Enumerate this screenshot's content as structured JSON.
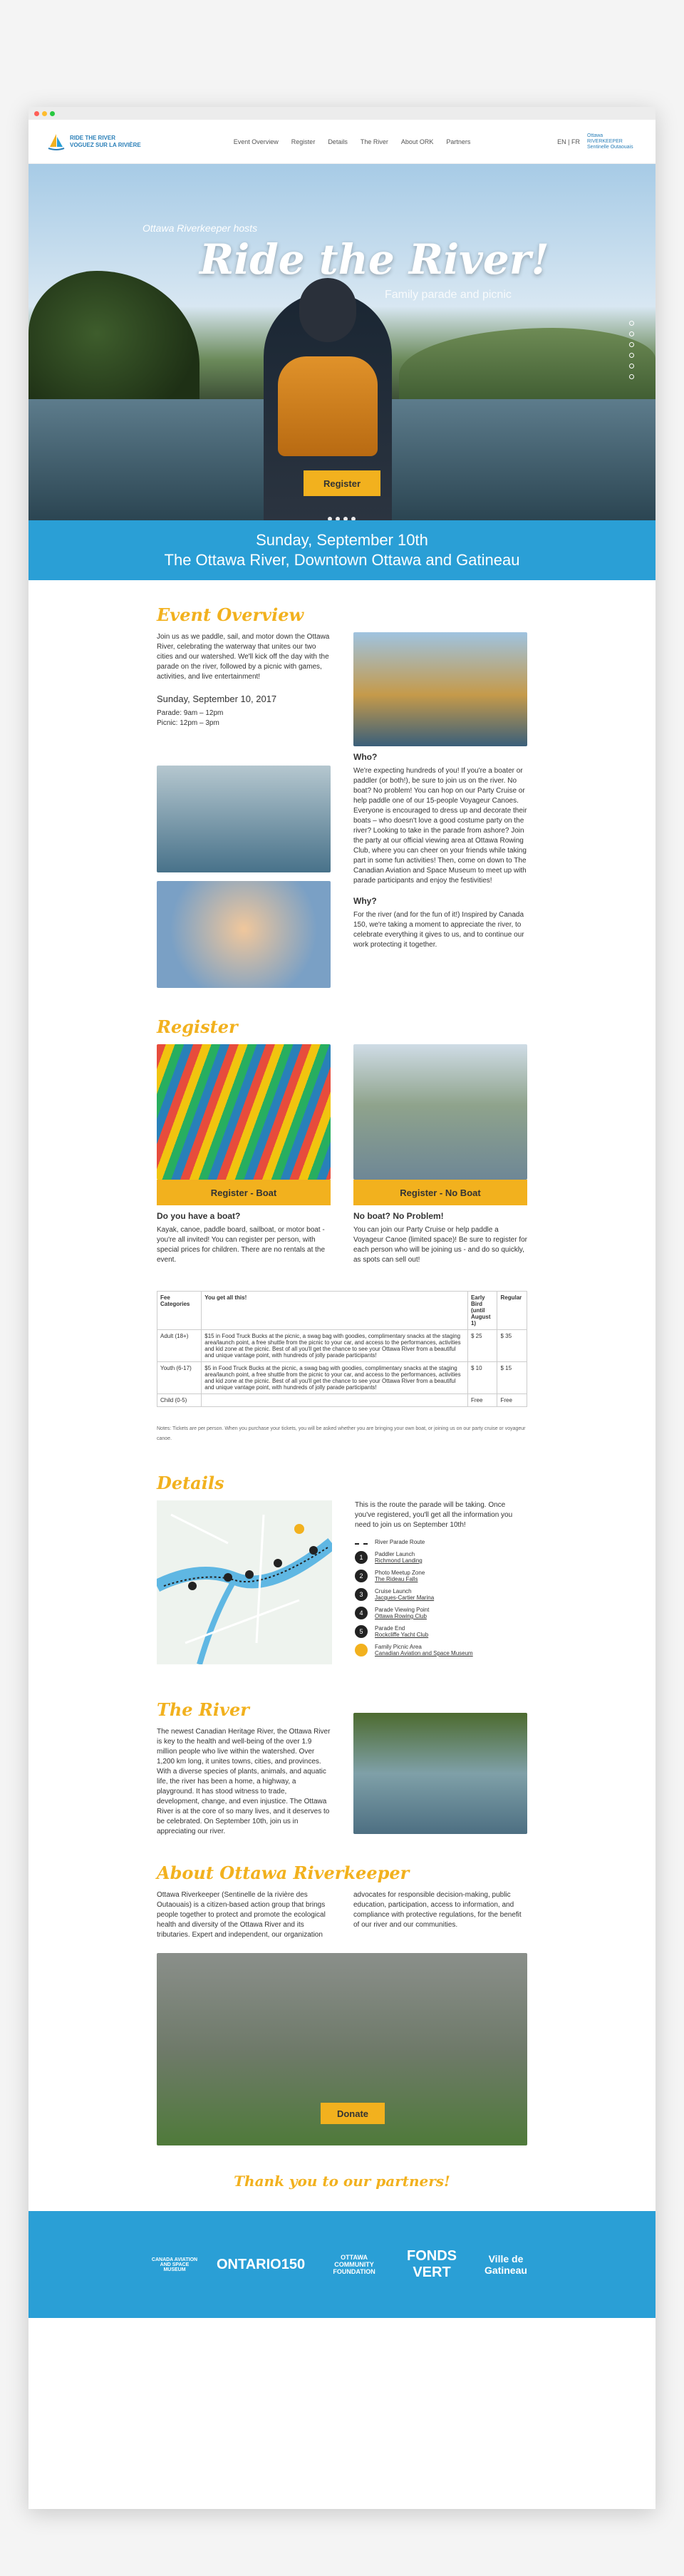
{
  "nav": {
    "logo_line1": "RIDE THE RIVER",
    "logo_line2": "VOGUEZ SUR LA RIVIÈRE",
    "items": [
      "Event Overview",
      "Register",
      "Details",
      "The River",
      "About ORK",
      "Partners"
    ],
    "lang": "EN | FR",
    "partner_logo": "Ottawa RIVERKEEPER Sentinelle Outaouais"
  },
  "hero": {
    "kicker": "Ottawa Riverkeeper hosts",
    "title": "Ride the River!",
    "subtitle": "Family parade and picnic",
    "register_button": "Register"
  },
  "date_band": {
    "line1": "Sunday, September 10th",
    "line2": "The Ottawa River, Downtown Ottawa and Gatineau"
  },
  "overview": {
    "title": "Event Overview",
    "intro": "Join us as we paddle, sail, and motor down the Ottawa River, celebrating the waterway that unites our two cities and our watershed. We'll kick off the day with the parade on the river, followed by a picnic with games, activities, and live entertainment!",
    "date": "Sunday, September 10, 2017",
    "parade": "Parade: 9am – 12pm",
    "picnic": "Picnic: 12pm – 3pm",
    "who_title": "Who?",
    "who_text": "We're expecting hundreds of you! If you're a boater or paddler (or both!), be sure to join us on the river. No boat? No problem! You can hop on our Party Cruise or help paddle one of our 15-people Voyageur Canoes. Everyone is encouraged to dress up and decorate their boats – who doesn't love a good costume party on the river? Looking to take in the parade from ashore? Join the party at our official viewing area at Ottawa Rowing Club, where you can cheer on your friends while taking part in some fun activities! Then, come on down to The Canadian Aviation and Space Museum to meet up with parade participants and enjoy the festivities!",
    "why_title": "Why?",
    "why_text": "For the river (and for the fun of it!) Inspired by Canada 150, we're taking a moment to appreciate the river, to celebrate everything it gives to us, and to continue our work protecting it together."
  },
  "register": {
    "title": "Register",
    "boat_button": "Register - Boat",
    "noboat_button": "Register - No Boat",
    "boat_heading": "Do you have a boat?",
    "boat_text": "Kayak, canoe, paddle board, sailboat, or motor boat - you're all invited! You can register per person, with special prices for children. There are no rentals at the event.",
    "noboat_heading": "No boat? No Problem!",
    "noboat_text": "You can join our Party Cruise or help paddle a Voyageur Canoe (limited space)! Be sure to register for each person who will be joining us - and do so quickly, as spots can sell out!",
    "table": {
      "headers": [
        "Fee Categories",
        "You get all this!",
        "Early Bird (until August 1)",
        "Regular"
      ],
      "rows": [
        [
          "Adult (18+)",
          "$15 in Food Truck Bucks at the picnic, a swag bag with goodies, complimentary snacks at the staging area/launch point, a free shuttle from the picnic to your car, and access to the performances, activities and kid zone at the picnic. Best of all you'll get the chance to see your Ottawa River from a beautiful and unique vantage point, with hundreds of jolly parade participants!",
          "$ 25",
          "$ 35"
        ],
        [
          "Youth (6-17)",
          "$5 in Food Truck Bucks at the picnic, a swag bag with goodies, complimentary snacks at the staging area/launch point, a free shuttle from the picnic to your car, and access to the performances, activities and kid zone at the picnic. Best of all you'll get the chance to see your Ottawa River from a beautiful and unique vantage point, with hundreds of jolly parade participants!",
          "$ 10",
          "$ 15"
        ],
        [
          "Child (0-5)",
          "",
          "Free",
          "Free"
        ]
      ]
    },
    "note": "Notes: Tickets are per person. When you purchase your tickets, you will be asked whether you are bringing your own boat, or joining us on our party cruise or voyageur canoe."
  },
  "details": {
    "title": "Details",
    "intro": "This is the route the parade will be taking. Once you've registered, you'll get all the information you need to join us on September 10th!",
    "route_label": "River Parade Route",
    "points": [
      {
        "n": "1",
        "name": "Paddler Launch",
        "place": "Richmond Landing"
      },
      {
        "n": "2",
        "name": "Photo Meetup Zone",
        "place": "The Rideau Falls"
      },
      {
        "n": "3",
        "name": "Cruise Launch",
        "place": "Jacques-Cartier Marina"
      },
      {
        "n": "4",
        "name": "Parade Viewing Point",
        "place": "Ottawa Rowing Club"
      },
      {
        "n": "5",
        "name": "Parade End",
        "place": "Rockcliffe Yacht Club"
      }
    ],
    "picnic_name": "Family Picnic Area",
    "picnic_place": "Canadian Aviation and Space Museum"
  },
  "river": {
    "title": "The River",
    "text": "The newest Canadian Heritage River, the Ottawa River is key to the health and well-being of the over 1.9 million people who live within the watershed. Over 1,200 km long, it unites towns, cities, and provinces. With a diverse species of plants, animals, and aquatic life, the river has been a home, a highway, a playground. It has stood witness to trade, development, change, and even injustice. The Ottawa River is at the core of so many lives, and it deserves to be celebrated. On September 10th, join us in appreciating our river."
  },
  "about": {
    "title": "About Ottawa Riverkeeper",
    "left": "Ottawa Riverkeeper (Sentinelle de la rivière des Outaouais) is a citizen-based action group that brings people together to protect and promote the ecological health and diversity of the Ottawa River and its tributaries. Expert and independent, our organization",
    "right": "advocates for responsible decision-making, public education, participation, access to information, and compliance with protective regulations, for the benefit of our river and our communities.",
    "donate_button": "Donate"
  },
  "partners": {
    "title": "Thank you to our partners!",
    "logos": [
      "CANADA AVIATION AND SPACE MUSEUM",
      "ONTARIO150",
      "OTTAWA COMMUNITY FOUNDATION",
      "FONDS VERT",
      "Ville de Gatineau"
    ]
  },
  "colors": {
    "accent": "#f2b11e",
    "blue": "#2a9fd6"
  }
}
